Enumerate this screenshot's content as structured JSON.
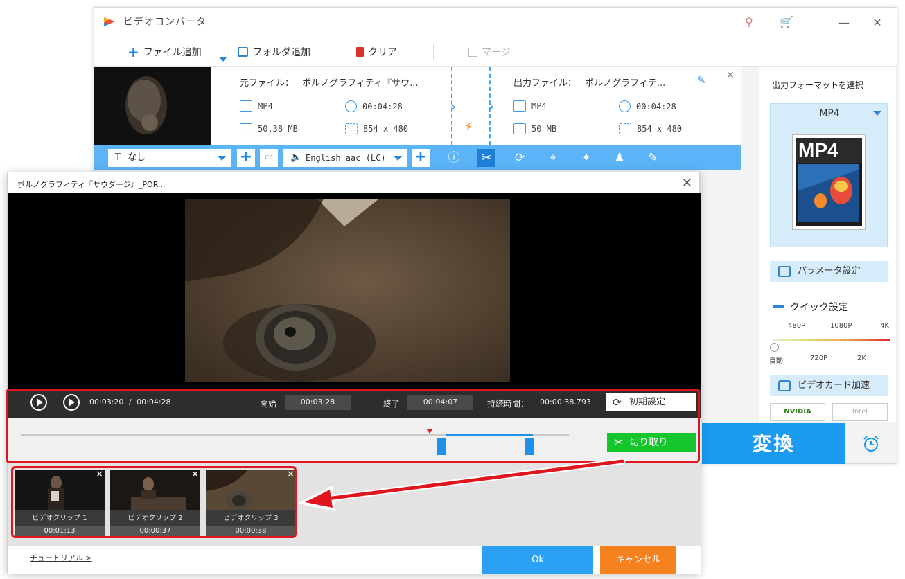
{
  "app": {
    "title": "ビデオコンバータ"
  },
  "toolbar": {
    "add_file": "ファイル追加",
    "add_folder": "フォルダ追加",
    "clear": "クリア",
    "merge": "マージ"
  },
  "file": {
    "source_label": "元ファイル：",
    "source_name": "ポルノグラフィティ『サウ...",
    "output_label": "出力ファイル：",
    "output_name": "ポルノグラフィテ...",
    "src_format": "MP4",
    "src_duration": "00:04:28",
    "src_size": "50.38 MB",
    "src_resolution": "854 x 480",
    "out_format": "MP4",
    "out_duration": "00:04:28",
    "out_size": "50 MB",
    "out_resolution": "854 x 480"
  },
  "editbar": {
    "subtitle_select": "なし",
    "audio_select": "English aac (LC)"
  },
  "right_panel": {
    "title": "出力フォーマットを選択",
    "format": "MP4",
    "format_image_text": "MP4",
    "params_button": "パラメータ設定",
    "quick_title": "クイック設定",
    "quality_top": [
      "480P",
      "1080P",
      "4K"
    ],
    "quality_bottom": [
      "自動",
      "720P",
      "2K"
    ],
    "gpu_button": "ビデオカード加速",
    "nvidia": "NVIDIA",
    "intel": "Intel",
    "convert": "変換"
  },
  "dialog": {
    "title": "ポルノグラフィティ『サウダージ』_POR...",
    "current_time": "00:03:20",
    "time_sep": "/",
    "total_time": "00:04:28",
    "start_label": "開始",
    "start_value": "00:03:28",
    "end_label": "終了",
    "end_value": "00:04:07",
    "duration_label": "持続時間：",
    "duration_value": "00:00:38.793",
    "reset_button": "初期設定",
    "cut_button": "切り取り",
    "clips": [
      {
        "name": "ビデオクリップ 1",
        "duration": "00:01:13"
      },
      {
        "name": "ビデオクリップ 2",
        "duration": "00:00:37"
      },
      {
        "name": "ビデオクリップ 3",
        "duration": "00:00:38"
      }
    ],
    "tutorial_link": "チュートリアル >",
    "ok_button": "Ok",
    "cancel_button": "キャンセル"
  },
  "colors": {
    "accent": "#1a9bf0",
    "edit_bar": "#5bb4f7",
    "cut_green": "#16c42c",
    "cancel_orange": "#f5811f",
    "annotation_red": "#e0161e"
  }
}
